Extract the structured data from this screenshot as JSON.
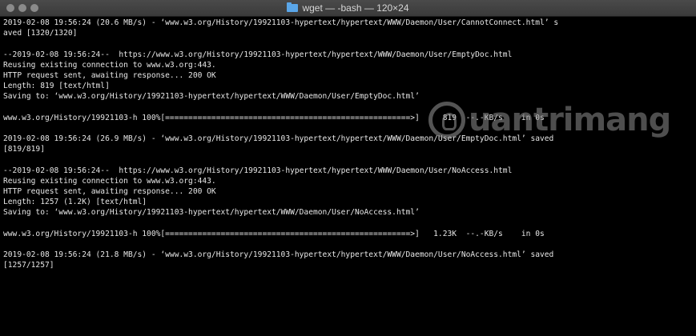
{
  "window": {
    "title": "wget — -bash — 120×24"
  },
  "watermark": {
    "text": "uantrimang"
  },
  "terminal": {
    "lines": [
      "2019-02-08 19:56:24 (20.6 MB/s) - ‘www.w3.org/History/19921103-hypertext/hypertext/WWW/Daemon/User/CannotConnect.html’ s",
      "aved [1320/1320]",
      "",
      "--2019-02-08 19:56:24--  https://www.w3.org/History/19921103-hypertext/hypertext/WWW/Daemon/User/EmptyDoc.html",
      "Reusing existing connection to www.w3.org:443.",
      "HTTP request sent, awaiting response... 200 OK",
      "Length: 819 [text/html]",
      "Saving to: ‘www.w3.org/History/19921103-hypertext/hypertext/WWW/Daemon/User/EmptyDoc.html’",
      "",
      "www.w3.org/History/19921103-h 100%[=====================================================>]     819  --.-KB/s    in 0s",
      "",
      "2019-02-08 19:56:24 (26.9 MB/s) - ‘www.w3.org/History/19921103-hypertext/hypertext/WWW/Daemon/User/EmptyDoc.html’ saved",
      "[819/819]",
      "",
      "--2019-02-08 19:56:24--  https://www.w3.org/History/19921103-hypertext/hypertext/WWW/Daemon/User/NoAccess.html",
      "Reusing existing connection to www.w3.org:443.",
      "HTTP request sent, awaiting response... 200 OK",
      "Length: 1257 (1.2K) [text/html]",
      "Saving to: ‘www.w3.org/History/19921103-hypertext/hypertext/WWW/Daemon/User/NoAccess.html’",
      "",
      "www.w3.org/History/19921103-h 100%[=====================================================>]   1.23K  --.-KB/s    in 0s",
      "",
      "2019-02-08 19:56:24 (21.8 MB/s) - ‘www.w3.org/History/19921103-hypertext/hypertext/WWW/Daemon/User/NoAccess.html’ saved",
      "[1257/1257]"
    ]
  }
}
